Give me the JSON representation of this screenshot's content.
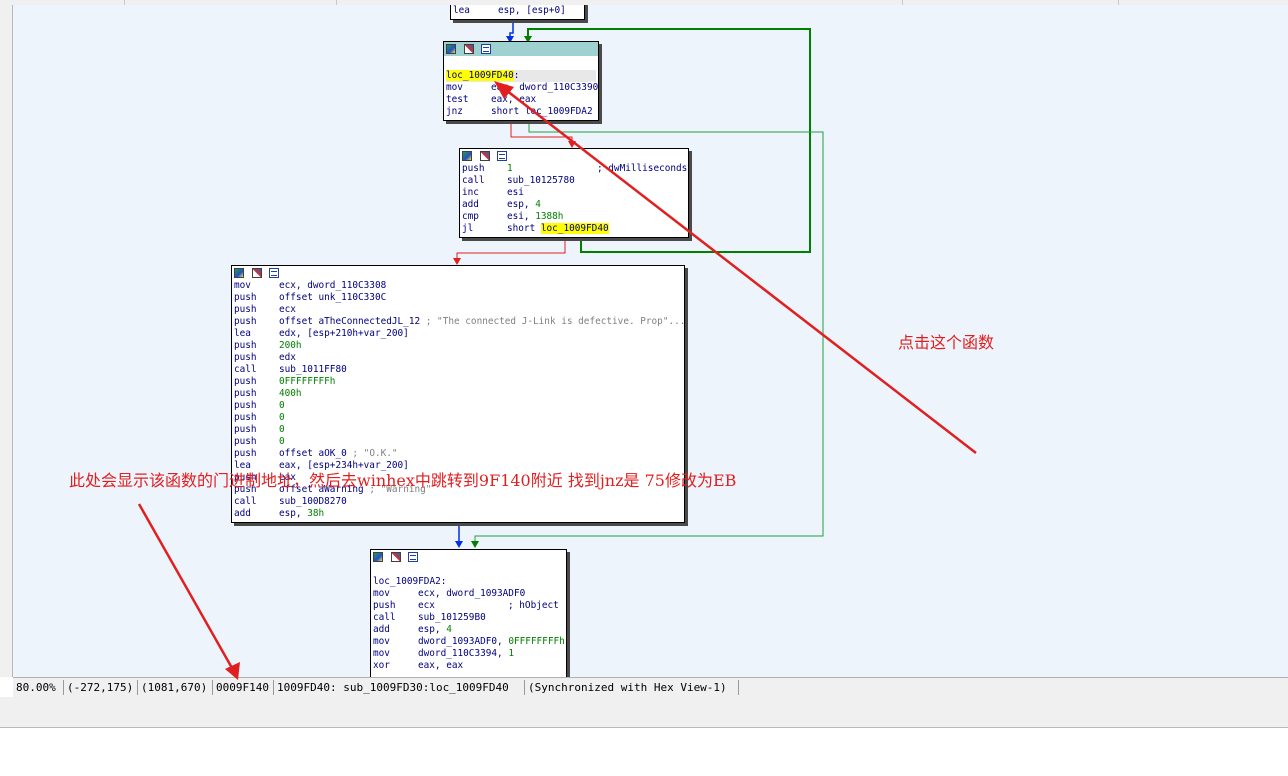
{
  "graph": {
    "blocks": [
      {
        "id": "block-top",
        "lines": [
          {
            "m": "lea",
            "o": "esp, [esp+0]"
          }
        ]
      },
      {
        "id": "block-loc-1009fd40",
        "lines": [
          {
            "label": "loc_1009FD40",
            "suffix": ":"
          },
          {
            "m": "mov",
            "o": "eax, dword_110C3390"
          },
          {
            "m": "test",
            "o": "eax, eax"
          },
          {
            "m": "jnz",
            "o": "short loc_1009FDA2"
          }
        ]
      },
      {
        "id": "block-sleep-loop",
        "lines": [
          {
            "m": "push",
            "o": "1",
            "c": "; dwMilliseconds"
          },
          {
            "m": "call",
            "o": "sub_10125780"
          },
          {
            "m": "inc",
            "o": "esi"
          },
          {
            "m": "add",
            "o": "esp, 4"
          },
          {
            "m": "cmp",
            "o": "esi, 1388h"
          },
          {
            "m": "jl",
            "o": "short ",
            "label": "loc_1009FD40"
          }
        ]
      },
      {
        "id": "block-warning",
        "lines": [
          {
            "m": "mov",
            "o": "ecx, dword_110C3308"
          },
          {
            "m": "push",
            "o": "offset unk_110C330C"
          },
          {
            "m": "push",
            "o": "ecx"
          },
          {
            "m": "push",
            "o": "offset aTheConnectedJL_12",
            "c": "; \"The connected J-Link is defective. Prop\"..."
          },
          {
            "m": "lea",
            "o": "edx, [esp+210h+var_200]"
          },
          {
            "m": "push",
            "o": "200h"
          },
          {
            "m": "push",
            "o": "edx"
          },
          {
            "m": "call",
            "o": "sub_1011FF80"
          },
          {
            "m": "push",
            "o": "0FFFFFFFFh"
          },
          {
            "m": "push",
            "o": "400h"
          },
          {
            "m": "push",
            "o": "0"
          },
          {
            "m": "push",
            "o": "0"
          },
          {
            "m": "push",
            "o": "0"
          },
          {
            "m": "push",
            "o": "0"
          },
          {
            "m": "push",
            "o": "offset aOK_0",
            "c": "; \"O.K.\""
          },
          {
            "m": "lea",
            "o": "eax, [esp+234h+var_200]"
          },
          {
            "m": "push",
            "o": "eax"
          },
          {
            "m": "push",
            "o": "offset aWarning",
            "c": "; \"Warning\""
          },
          {
            "m": "call",
            "o": "sub_100D8270"
          },
          {
            "m": "add",
            "o": "esp, 38h"
          }
        ]
      },
      {
        "id": "block-loc-1009fda2",
        "lines": [
          {
            "label": "loc_1009FDA2",
            "suffix": ":",
            "plain": true
          },
          {
            "m": "mov",
            "o": "ecx, dword_1093ADF0"
          },
          {
            "m": "push",
            "o": "ecx",
            "c": "; hObject"
          },
          {
            "m": "call",
            "o": "sub_101259B0"
          },
          {
            "m": "add",
            "o": "esp, 4"
          },
          {
            "m": "mov",
            "o": "dword_1093ADF0, 0FFFFFFFFh"
          },
          {
            "m": "mov",
            "o": "dword_110C3394, 1"
          },
          {
            "m": "xor",
            "o": "eax, eax"
          }
        ]
      }
    ]
  },
  "annotations": {
    "click_function": "点击这个函数",
    "instructions": "此处会显示该函数的门进制地址，然后去winhex中跳转到9F140附近 找到jnz是 75修改为EB"
  },
  "statusbar": {
    "zoom": "80.00%",
    "coords1": "(-272,175)",
    "coords2": "(1081,670)",
    "file_offset": "0009F140",
    "location": "1009FD40: sub_1009FD30:loc_1009FD40",
    "sync": "(Synchronized with Hex View-1)"
  },
  "colors": {
    "edge_true": "#008000",
    "edge_false": "#e02020",
    "edge_uncond": "#0030e0",
    "annotation": "#e02020",
    "label_highlight": "#ffff00"
  }
}
